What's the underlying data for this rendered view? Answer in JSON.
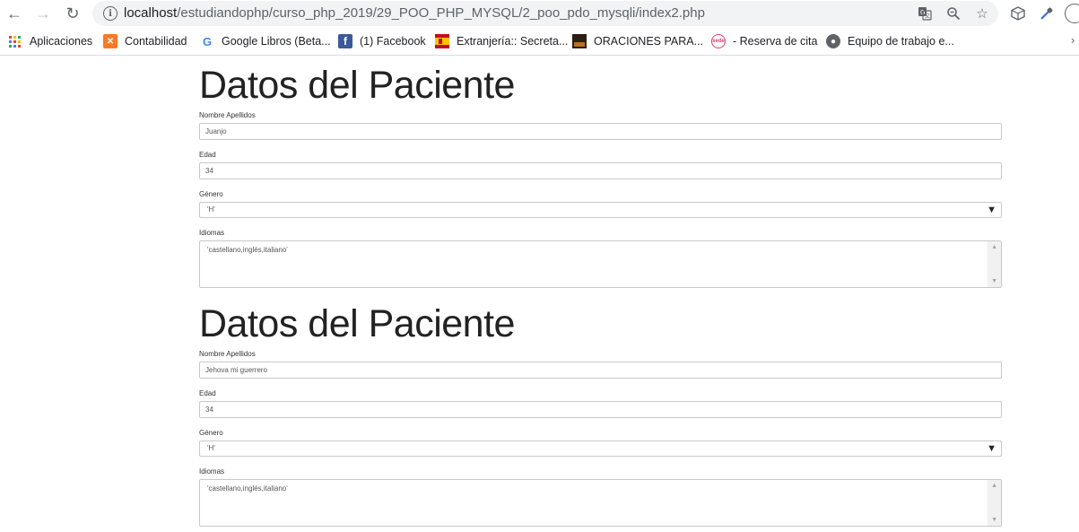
{
  "browser": {
    "url_host": "localhost",
    "url_path": "/estudiandophp/curso_php_2019/29_POO_PHP_MYSQL/2_poo_pdo_mysqli/index2.php"
  },
  "bookmarks": [
    {
      "label": "Aplicaciones",
      "icon": "apps-grid-icon",
      "color": "#e8453c"
    },
    {
      "label": "Contabilidad",
      "icon": "xampp-icon",
      "color": "#fb7a24"
    },
    {
      "label": "Google Libros (Beta...",
      "icon": "google-icon",
      "color": "#4285f4"
    },
    {
      "label": "(1) Facebook",
      "icon": "facebook-icon",
      "color": "#3b5998"
    },
    {
      "label": "Extranjería:: Secreta...",
      "icon": "spain-crest-icon",
      "color": "#c60b1e"
    },
    {
      "label": "ORACIONES PARA...",
      "icon": "oraciones-icon",
      "color": "#3a2a1a"
    },
    {
      "label": "- Reserva de cita",
      "icon": "reserva-icon",
      "color": "#d93f6e"
    },
    {
      "label": "Equipo de trabajo e...",
      "icon": "globe-icon",
      "color": "#5f6368"
    }
  ],
  "patients": [
    {
      "title": "Datos del Paciente",
      "name_label": "Nombre Apellidos",
      "name_value": "Juanjo",
      "age_label": "Edad",
      "age_value": "34",
      "gender_label": "Género",
      "gender_value": "'H'",
      "languages_label": "Idiomas",
      "languages_value": "'castellano,inglés,italiano'"
    },
    {
      "title": "Datos del Paciente",
      "name_label": "Nombre Apellidos",
      "name_value": "Jehova mi guerrero",
      "age_label": "Edad",
      "age_value": "34",
      "gender_label": "Género",
      "gender_value": "'H'",
      "languages_label": "Idiomas",
      "languages_value": "'castellano,inglés,italiano'"
    }
  ]
}
